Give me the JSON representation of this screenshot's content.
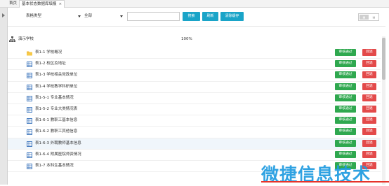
{
  "tabs": [
    {
      "label": "首页"
    },
    {
      "label": "基本状态数据库填报",
      "close": "×"
    }
  ],
  "toolbar": {
    "table_type": "表格类型",
    "scope": "全部",
    "search_value": "",
    "search_label": "搜索",
    "refresh_label": "刷新",
    "clear_cache_label": "清除缓存",
    "view_grid": "▦",
    "view_list": "▤"
  },
  "root": {
    "label": "演示学校",
    "percent": "100%"
  },
  "rows": [
    {
      "label": "表1-1 学校概况",
      "pass": "审核通过",
      "back": "回退"
    },
    {
      "label": "表1-2 校区及地址",
      "pass": "审核通过",
      "back": "回退"
    },
    {
      "label": "表1-3 学校相关党政单位",
      "pass": "审核通过",
      "back": "回退"
    },
    {
      "label": "表1-4 学校教学科研单位",
      "pass": "审核通过",
      "back": "回退"
    },
    {
      "label": "表1-5-1 专业基本情况",
      "pass": "审核通过",
      "back": "回退"
    },
    {
      "label": "表1-5-2 专业大类情况表",
      "pass": "审核通过",
      "back": "回退"
    },
    {
      "label": "表1-6-1 教职工基本信息",
      "pass": "审核通过",
      "back": "回退"
    },
    {
      "label": "表1-6-2 教职工其他信息",
      "pass": "审核通过",
      "back": "回退"
    },
    {
      "label": "表1-6-3 外聘教师基本信息",
      "pass": "审核通过",
      "back": "回退"
    },
    {
      "label": "表1-6-4 附属医院师资情况",
      "pass": "审核通过",
      "back": "回退"
    },
    {
      "label": "表1-7 本科生基本情况",
      "pass": "审核通过",
      "back": "回退"
    }
  ],
  "watermark": {
    "text": "微捷信息技术"
  },
  "colors": {
    "accent": "#1aa4c8",
    "pass": "#2fa84f",
    "back": "#e34a4a"
  }
}
